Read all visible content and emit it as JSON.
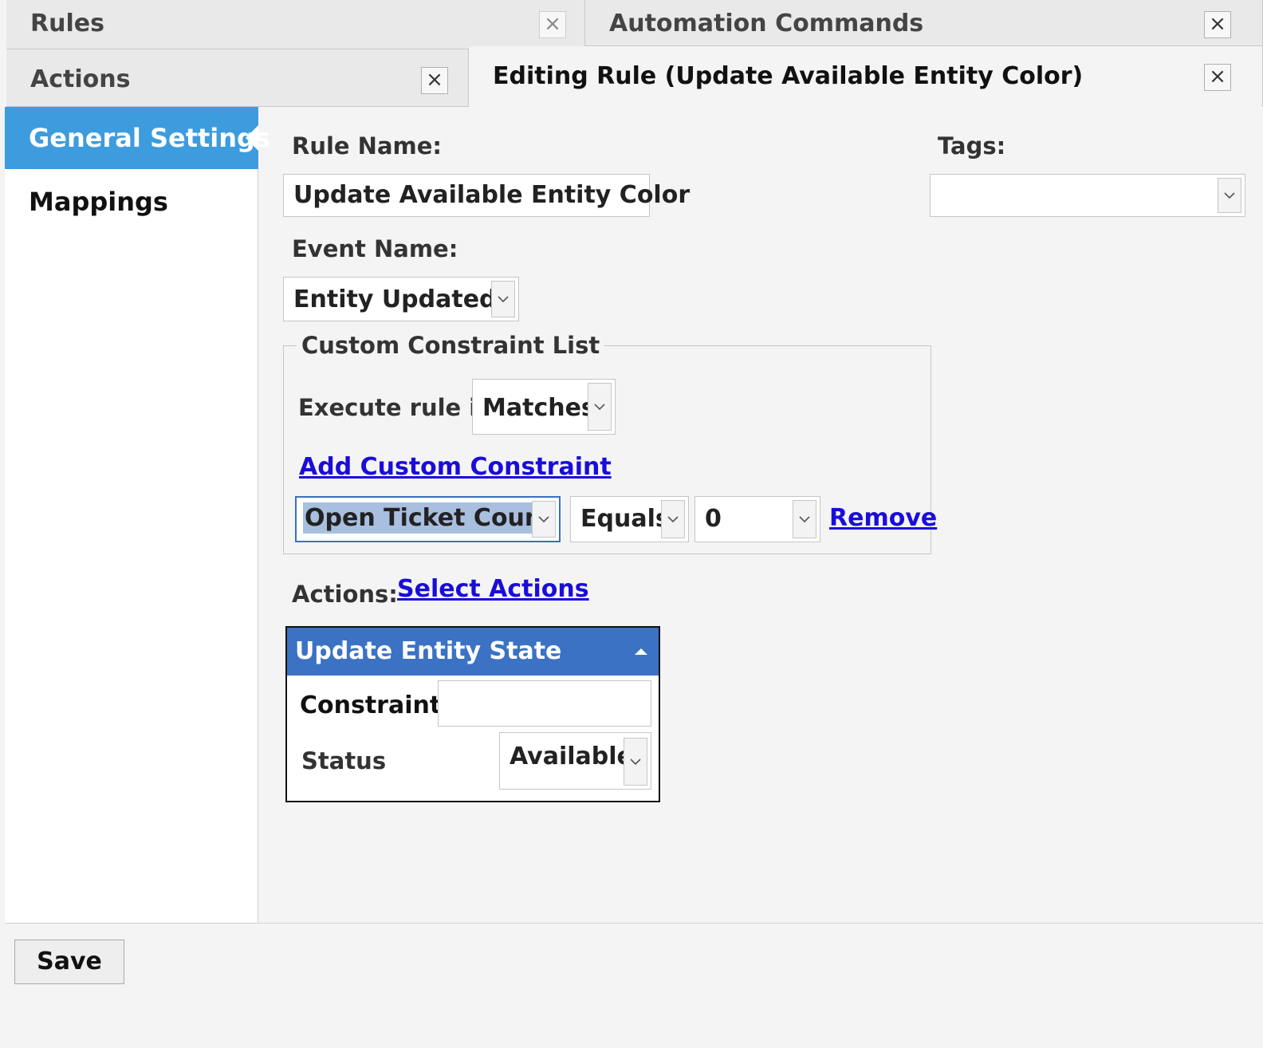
{
  "tabs": {
    "row1": [
      {
        "label": "Rules",
        "close": "×"
      },
      {
        "label": "Automation Commands",
        "close": "×"
      }
    ],
    "row2": [
      {
        "label": "Actions",
        "close": "×"
      },
      {
        "label": "Editing Rule (Update Available Entity Color)",
        "close": "×"
      }
    ]
  },
  "sidebar": {
    "items": [
      {
        "label": "General Settings",
        "active": true
      },
      {
        "label": "Mappings",
        "active": false
      }
    ]
  },
  "form": {
    "rule_name_label": "Rule Name:",
    "rule_name_value": "Update Available Entity Color",
    "tags_label": "Tags:",
    "tags_value": "",
    "event_name_label": "Event Name:",
    "event_name_value": "Entity Updated"
  },
  "constraints": {
    "legend": "Custom Constraint List",
    "execute_label": "Execute rule if",
    "execute_value": "Matches",
    "add_link": "Add Custom Constraint",
    "row": {
      "field": "Open Ticket Count",
      "operator": "Equals",
      "value": "0",
      "remove_link": "Remove"
    }
  },
  "actions": {
    "label": "Actions:",
    "select_link": "Select Actions",
    "panel": {
      "title": "Update Entity State",
      "constraint_label": "Constraint:",
      "constraint_value": "",
      "status_label": "Status",
      "status_value": "Available"
    }
  },
  "footer": {
    "save_label": "Save"
  },
  "colors": {
    "accent": "#3d9cde",
    "panel_header": "#3b72c4",
    "link": "#1a0dd8",
    "selection": "#a9bfe0"
  },
  "icons": {
    "close": "close-icon",
    "dropdown": "chevron-down-icon",
    "collapse": "triangle-up-icon"
  }
}
